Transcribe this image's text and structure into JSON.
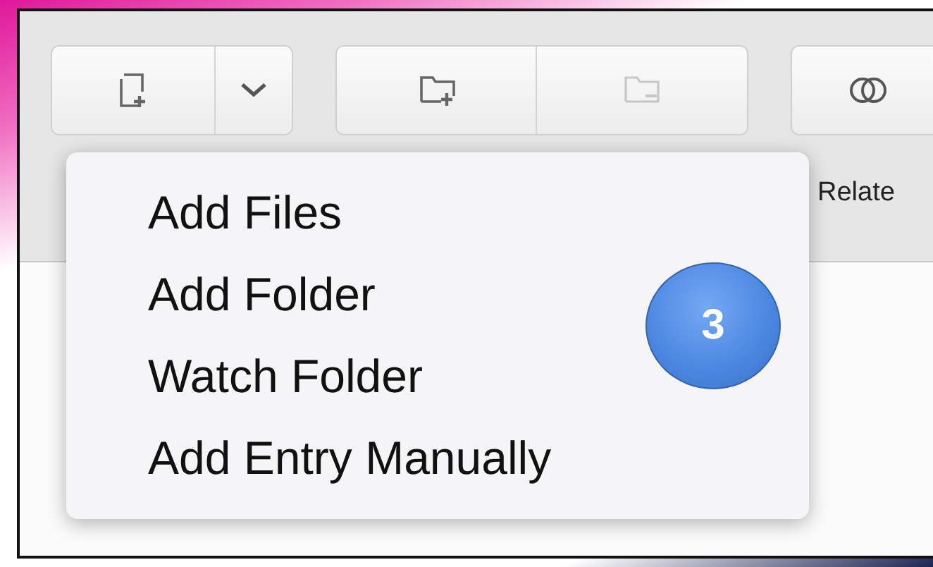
{
  "toolbar": {
    "buttons": [
      {
        "kind": "add-file",
        "disabled": false
      },
      {
        "kind": "menu-caret",
        "disabled": false
      },
      {
        "kind": "add-folder",
        "disabled": false
      },
      {
        "kind": "remove-folder",
        "disabled": true
      },
      {
        "kind": "related",
        "disabled": false
      }
    ],
    "label": "Relate"
  },
  "menu": {
    "items": [
      "Add Files",
      "Add Folder",
      "Watch Folder",
      "Add Entry Manually"
    ]
  },
  "callout_badge": "3"
}
